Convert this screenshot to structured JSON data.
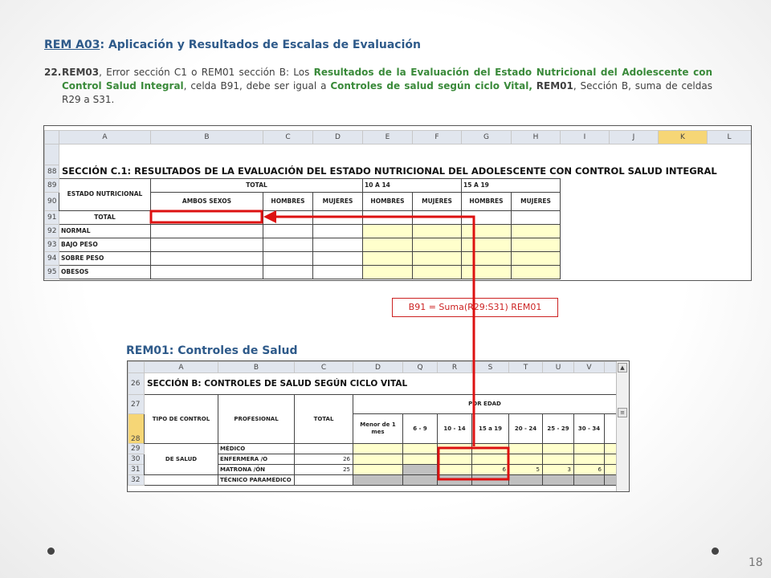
{
  "title": {
    "link": "REM A03",
    "rest": ": Aplicación y Resultados de Escalas de Evaluación"
  },
  "item": {
    "number": "22.",
    "t1": "REM03",
    "t2": ", Error sección C1 o REM01 sección B: Los ",
    "t3": "Resultados de la Evaluación del Estado Nutricional del Adolescente con Control Salud Integral",
    "t4": ", celda B91, debe ser igual a ",
    "t5": "Controles de salud según ciclo Vital,",
    "t6": " ",
    "t7": "REM01",
    "t8": ", Sección B, suma de celdas R29 a S31."
  },
  "sheet1": {
    "columns": [
      "A",
      "B",
      "C",
      "D",
      "E",
      "F",
      "G",
      "H",
      "I",
      "J",
      "K",
      "L"
    ],
    "rows": [
      "88",
      "89",
      "90",
      "91",
      "92",
      "93",
      "94",
      "95"
    ],
    "section_title": "SECCIÓN C.1: RESULTADOS DE LA EVALUACIÓN DEL ESTADO NUTRICIONAL DEL ADOLESCENTE CON CONTROL SALUD INTEGRAL",
    "estado": "ESTADO NUTRICIONAL",
    "total_header": "TOTAL",
    "age1": "10 A 14",
    "age2": "15 A 19",
    "ambos": "AMBOS SEXOS",
    "hombres": "HOMBRES",
    "mujeres": "MUJERES",
    "labels": [
      "TOTAL",
      "NORMAL",
      "BAJO PESO",
      "SOBRE PESO",
      "OBESOS"
    ]
  },
  "formula": "B91 =  Suma(R29:S31) REM01",
  "subtitle": "REM01: Controles de Salud",
  "sheet2": {
    "columns": [
      "A",
      "B",
      "C",
      "D",
      "Q",
      "R",
      "S",
      "T",
      "U",
      "V"
    ],
    "rows": [
      "26",
      "27",
      "28",
      "29",
      "30",
      "31",
      "32"
    ],
    "section_title": "SECCIÓN B: CONTROLES DE SALUD SEGÚN CICLO VITAL",
    "tipo": "TIPO DE CONTROL",
    "profesional": "PROFESIONAL",
    "total": "TOTAL",
    "por_edad": "POR EDAD",
    "ages": [
      "Menor de 1 mes",
      "6  -  9",
      "10 - 14",
      "15 a 19",
      "20 - 24",
      "25 - 29",
      "30 - 34"
    ],
    "de_salud": "DE SALUD",
    "professionals": [
      "MÉDICO",
      "ENFERMERA /O",
      "MATRONA /ÓN",
      "TÉCNICO PARAMÉDICO"
    ],
    "total_enfermera": "26",
    "total_matrona": "25",
    "row31_s": "6",
    "row31_t": "5",
    "row31_u": "3",
    "row31_v": "6"
  },
  "slide_number": "18",
  "colors": {
    "title_blue": "#2e5a8a",
    "highlight_green": "#3a8a3a",
    "highlight_red": "#dd1111",
    "input_yellow": "#ffffcc",
    "header_gray": "#e1e6ee",
    "selected_col": "#f6d676"
  }
}
